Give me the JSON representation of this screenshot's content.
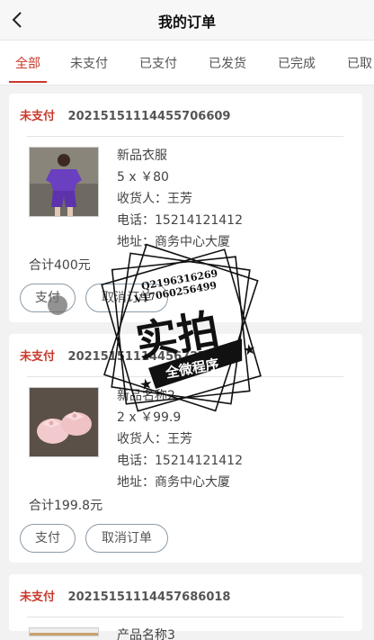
{
  "header": {
    "title": "我的订单",
    "back_icon": "chevron-left-icon"
  },
  "tabs": [
    {
      "label": "全部",
      "active": true
    },
    {
      "label": "未支付",
      "active": false
    },
    {
      "label": "已支付",
      "active": false
    },
    {
      "label": "已发货",
      "active": false
    },
    {
      "label": "已完成",
      "active": false
    },
    {
      "label": "已取",
      "active": false
    }
  ],
  "orders": [
    {
      "status": "未支付",
      "order_no": "20215151114455706609",
      "product_name": "新品衣服",
      "qty_price": "5 x ￥80",
      "recipient": "收货人：王芳",
      "phone": "电话：15214121412",
      "address": "地址：商务中心大厦",
      "total": "合计400元",
      "pay_label": "支付",
      "cancel_label": "取消订单"
    },
    {
      "status": "未支付",
      "order_no": "2021515111445672702",
      "product_name": "新品名称2",
      "qty_price": "2 x ￥99.9",
      "recipient": "收货人：王芳",
      "phone": "电话：15214121412",
      "address": "地址：商务中心大厦",
      "total": "合计199.8元",
      "pay_label": "支付",
      "cancel_label": "取消订单"
    },
    {
      "status": "未支付",
      "order_no": "20215151114457686018",
      "product_name": "产品名称3"
    }
  ],
  "watermark": {
    "qq": "Q2196316269",
    "vx": "V17060256499",
    "main": "实拍",
    "ribbon": "全微程序"
  },
  "colors": {
    "accent": "#c9392c",
    "background": "#f2f2f2",
    "card": "#ffffff"
  }
}
